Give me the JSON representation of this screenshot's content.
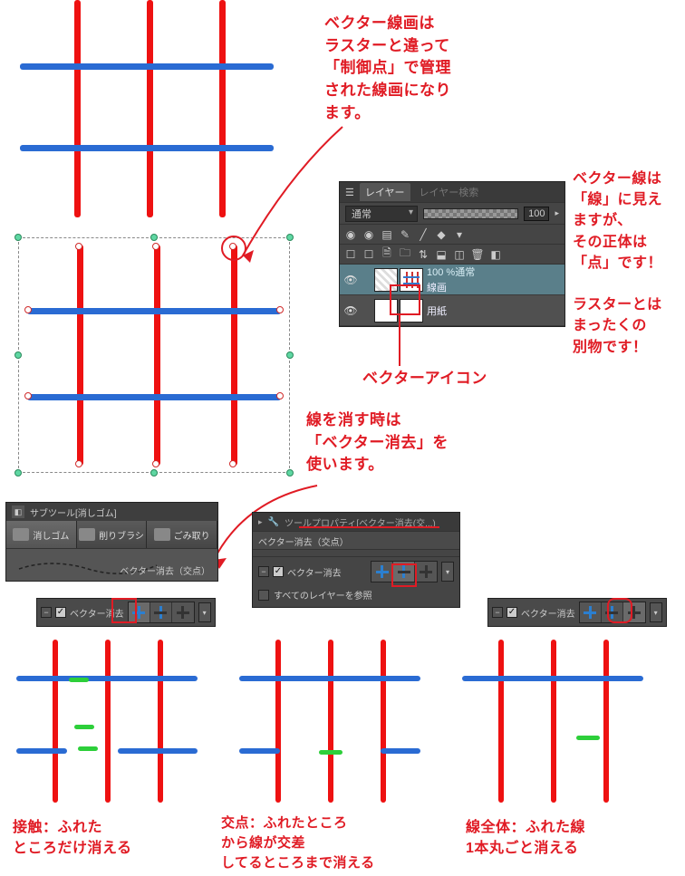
{
  "annot": {
    "a1": "ベクター線画は\nラスターと違って\n「制御点」で管理\nされた線画になり\nます。",
    "a2": "ベクター線は\n「線」に見え\nますが、\nその正体は\n「点」です！\n\nラスターとは\nまったくの\n別物です！",
    "a3": "ベクターアイコン",
    "a4": "線を消す時は\n「ベクター消去」を\n使います。",
    "c1": "接触：ふれた\nところだけ消える",
    "c2": "交点：ふれたところ\nから線が交差\nしてるところまで消える",
    "c3": "線全体：ふれた線\n1本丸ごと消える"
  },
  "layerPanel": {
    "tab1": "レイヤー",
    "tab2": "レイヤー検索",
    "blend": "通常",
    "opacity": "100",
    "layer1_top": "100 %通常",
    "layer1_name": "線画",
    "layer2_name": "用紙"
  },
  "subtool": {
    "title": "サブツール[消しゴム]",
    "tab1": "消しゴム",
    "tab2": "削りブラシ",
    "tab3": "ごみ取り",
    "preview": "ベクター消去（交点）"
  },
  "toolprop": {
    "title": "ツールプロパティ[ベクター消去(交...)",
    "sub": "ベクター消去（交点）",
    "label": "ベクター消去",
    "ref": "すべてのレイヤーを参照"
  }
}
